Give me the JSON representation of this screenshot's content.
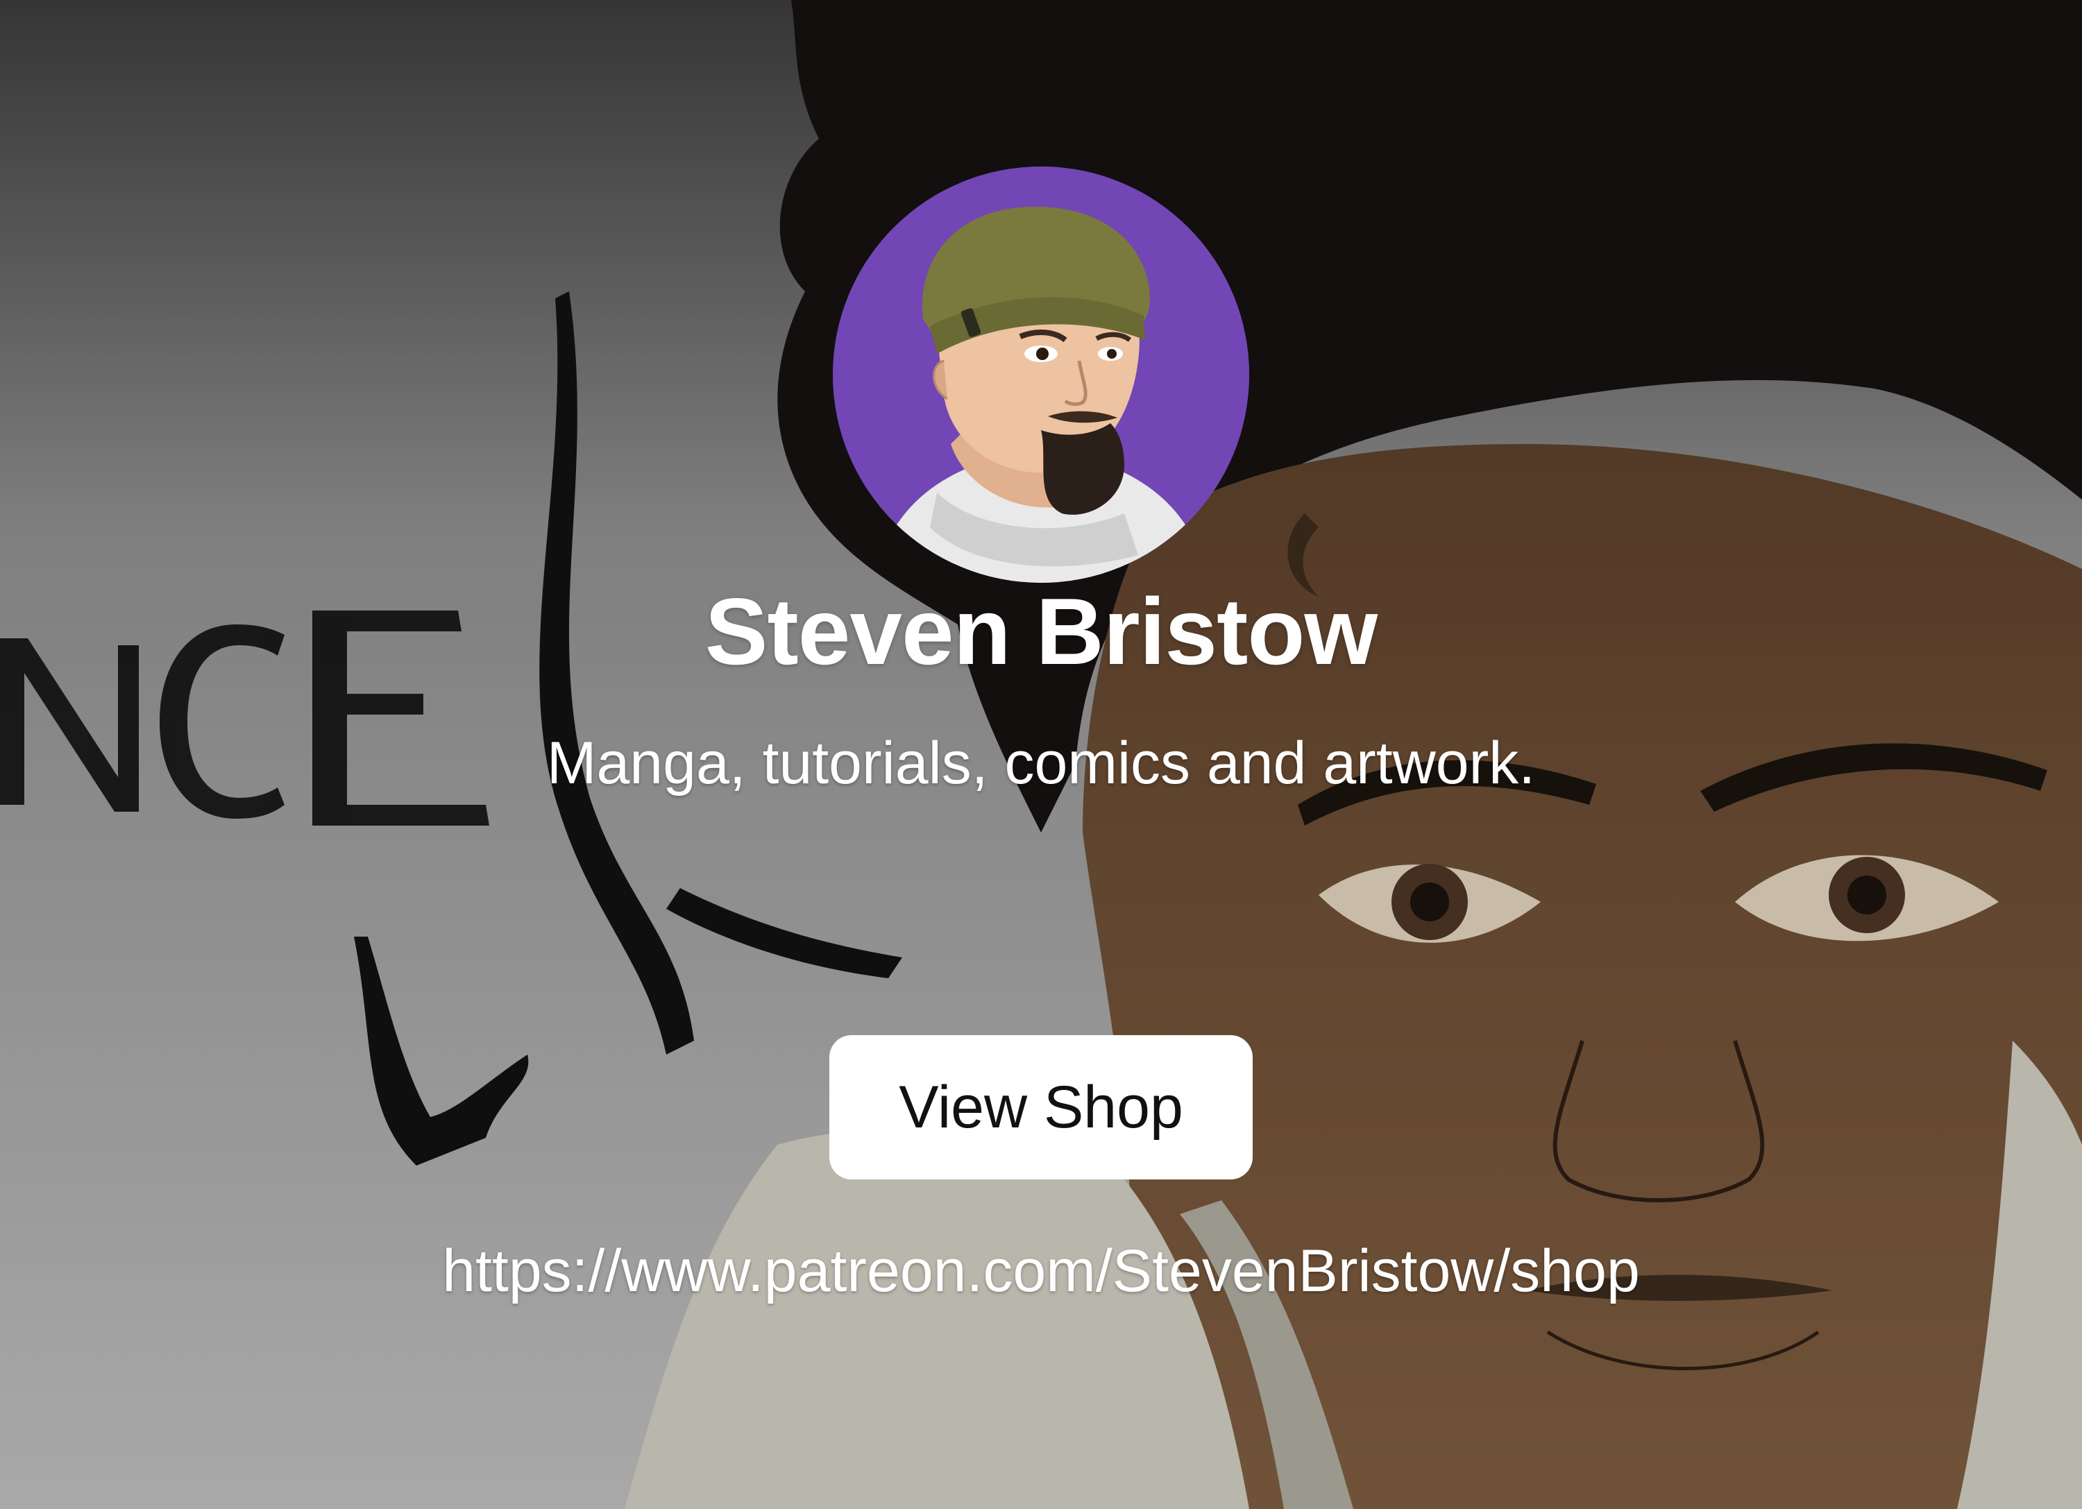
{
  "profile": {
    "name": "Steven Bristow",
    "tagline": "Manga, tutorials, comics and artwork.",
    "avatar_icon": "cartoon-portrait-avatar",
    "avatar_bg_color": "#7346b5"
  },
  "shop": {
    "button_label": "View Shop",
    "url": "https://www.patreon.com/StevenBristow/shop"
  },
  "background": {
    "art_text": "NCE",
    "colors": {
      "left_gradient_top": "#3a3a3a",
      "left_gradient_bottom": "#b5b5b5",
      "skin": "#6a4b33",
      "hair": "#141110",
      "shirt": "#c9c6bb"
    }
  }
}
